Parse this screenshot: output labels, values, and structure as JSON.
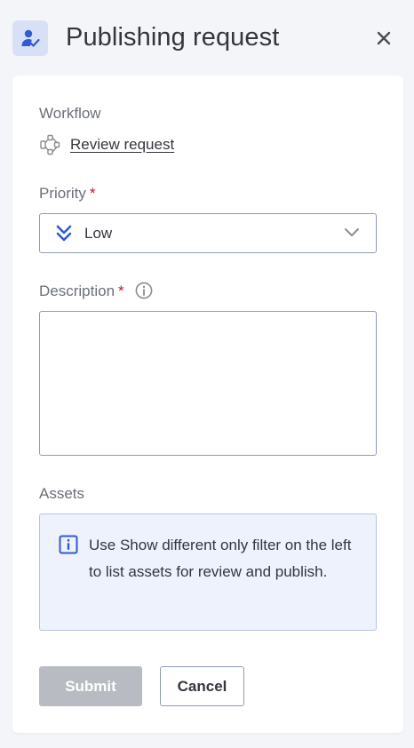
{
  "header": {
    "title": "Publishing request",
    "icon": "user-check-icon",
    "close_icon": "close-icon"
  },
  "workflow": {
    "label": "Workflow",
    "value": "Review request",
    "icon": "workflow-icon"
  },
  "priority": {
    "label": "Priority",
    "required_mark": "*",
    "value": "Low",
    "icon": "double-chevron-down-icon"
  },
  "description": {
    "label": "Description",
    "required_mark": "*",
    "value": "",
    "icon": "info-icon"
  },
  "assets": {
    "label": "Assets",
    "notice": "Use Show different only filter on the left to list assets for review and publish.",
    "icon": "info-square-icon"
  },
  "actions": {
    "submit_label": "Submit",
    "cancel_label": "Cancel"
  },
  "colors": {
    "accent": "#2f5bd3",
    "required": "#c8102e",
    "disabled_button": "#b8bbc2",
    "notice_bg": "#eef2fc"
  }
}
